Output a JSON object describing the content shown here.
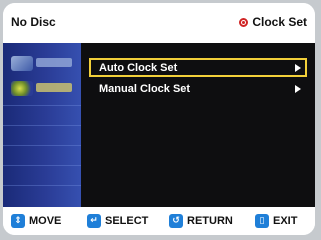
{
  "header": {
    "disc_status": "No Disc",
    "menu_title": "Clock Set"
  },
  "menu": {
    "items": [
      {
        "label": "Auto Clock Set",
        "selected": true
      },
      {
        "label": "Manual Clock Set",
        "selected": false
      }
    ]
  },
  "footer": {
    "move": "MOVE",
    "select": "SELECT",
    "return": "RETURN",
    "exit": "EXIT"
  },
  "colors": {
    "highlight": "#f2d03a",
    "accent": "#1f7fd8",
    "menu_bg": "#0e0e10",
    "sidebar_bg": "#2a3c96"
  },
  "icons": {
    "menu_title_icon": "clock-set-icon",
    "move": "updown-arrows-icon",
    "select": "enter-icon",
    "return": "return-arrow-icon",
    "exit": "exit-icon"
  }
}
